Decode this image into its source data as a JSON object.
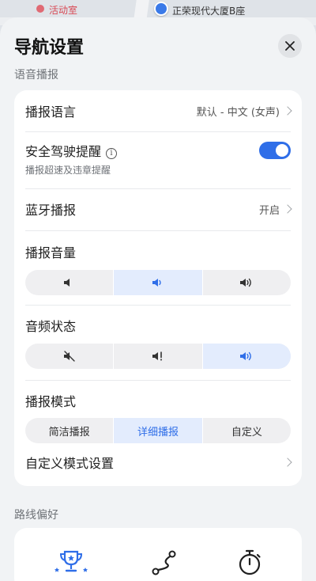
{
  "map": {
    "label_left": "活动室",
    "label_right": "正荣现代大厦B座"
  },
  "header": {
    "title": "导航设置"
  },
  "voice_section": {
    "label": "语音播报",
    "broadcast_language": {
      "label": "播报语言",
      "value": "默认 - 中文 (女声)"
    },
    "safe_driving": {
      "label": "安全驾驶提醒",
      "sub": "播报超速及违章提醒",
      "toggle_on": true
    },
    "bluetooth": {
      "label": "蓝牙播报",
      "value": "开启"
    },
    "volume": {
      "label": "播报音量",
      "selected_index": 1,
      "options": [
        "volume-low-icon",
        "volume-medium-icon",
        "volume-high-icon"
      ]
    },
    "audio_state": {
      "label": "音频状态",
      "selected_index": 2,
      "options": [
        "mute-icon",
        "volume-alert-icon",
        "volume-high-icon"
      ]
    },
    "mode": {
      "label": "播报模式",
      "options": [
        "简洁播报",
        "详细播报",
        "自定义"
      ],
      "selected_index": 1
    },
    "custom_mode": {
      "label": "自定义模式设置"
    }
  },
  "route_section": {
    "label": "路线偏好",
    "icons": [
      "trophy-icon",
      "route-icon",
      "stopwatch-icon"
    ]
  },
  "colors": {
    "accent": "#2f6ee8",
    "active_segment_bg": "#e3ecfd",
    "sheet_bg": "#f1f3f5",
    "card_bg": "#ffffff"
  }
}
